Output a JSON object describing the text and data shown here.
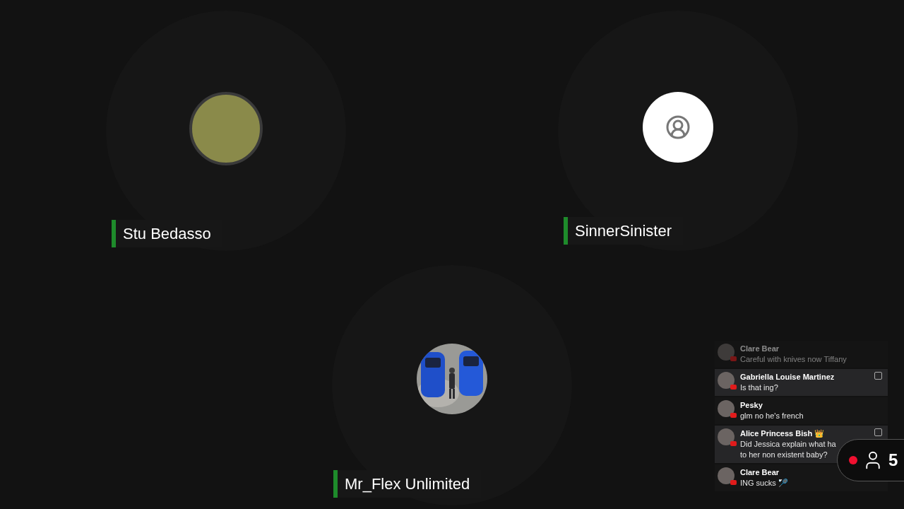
{
  "participants": [
    {
      "name": "Stu Bedasso",
      "kind": "plain"
    },
    {
      "name": "SinnerSinister",
      "kind": "placeholder"
    },
    {
      "name": "Mr_Flex Unlimited",
      "kind": "picture"
    }
  ],
  "chat": [
    {
      "author": "Clare Bear",
      "lines": [
        "Careful with knives now Tiffany"
      ],
      "faded": true,
      "highlighted": false
    },
    {
      "author": "Gabriella Louise Martinez",
      "lines": [
        "Is that ing?"
      ],
      "faded": false,
      "highlighted": true
    },
    {
      "author": "Pesky",
      "lines": [
        "glm no he's french"
      ],
      "faded": false,
      "highlighted": false
    },
    {
      "author": "Alice Princess Bish 👑",
      "lines": [
        "Did Jessica explain what ha",
        "to her non existent baby?"
      ],
      "faded": false,
      "highlighted": true
    },
    {
      "author": "Clare Bear",
      "lines": [
        "ING sucks 🏸"
      ],
      "faded": false,
      "highlighted": false
    }
  ],
  "viewer_pill": {
    "count": "5"
  }
}
